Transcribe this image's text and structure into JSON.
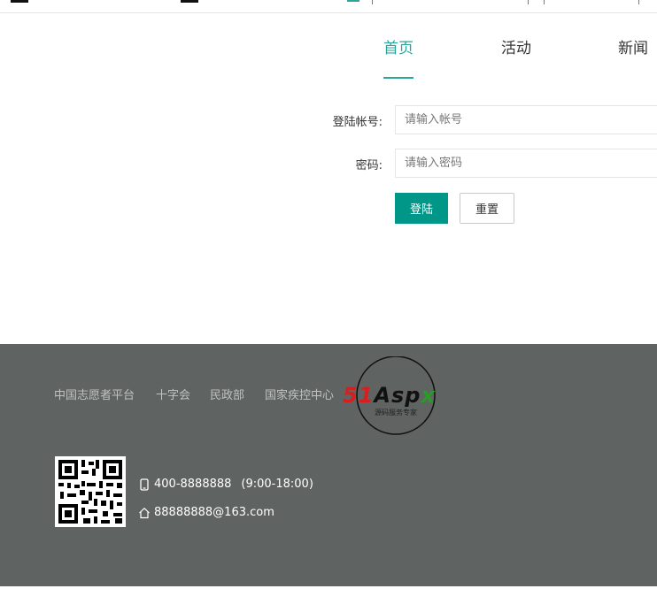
{
  "nav": {
    "items": [
      {
        "label": "首页",
        "active": true
      },
      {
        "label": "活动",
        "active": false
      },
      {
        "label": "新闻",
        "active": false
      }
    ]
  },
  "login": {
    "account_label": "登陆帐号:",
    "account_placeholder": "请输入帐号",
    "password_label": "密码:",
    "password_placeholder": "请输入密码",
    "submit_label": "登陆",
    "reset_label": "重置"
  },
  "footer": {
    "links": [
      "中国志愿者平台",
      "十字会",
      "民政部",
      "国家疾控中心"
    ],
    "phone": "400-8888888",
    "hours": "(9:00-18:00)",
    "email": "88888888@163.com"
  },
  "watermark": {
    "brand": "51Aspx",
    "tagline": "源码服务专家"
  },
  "colors": {
    "accent": "#2aa59b",
    "primary_button": "#009688",
    "footer_bg": "#5f6361"
  },
  "icons": [
    "phone-icon",
    "home-icon",
    "qr-code"
  ]
}
